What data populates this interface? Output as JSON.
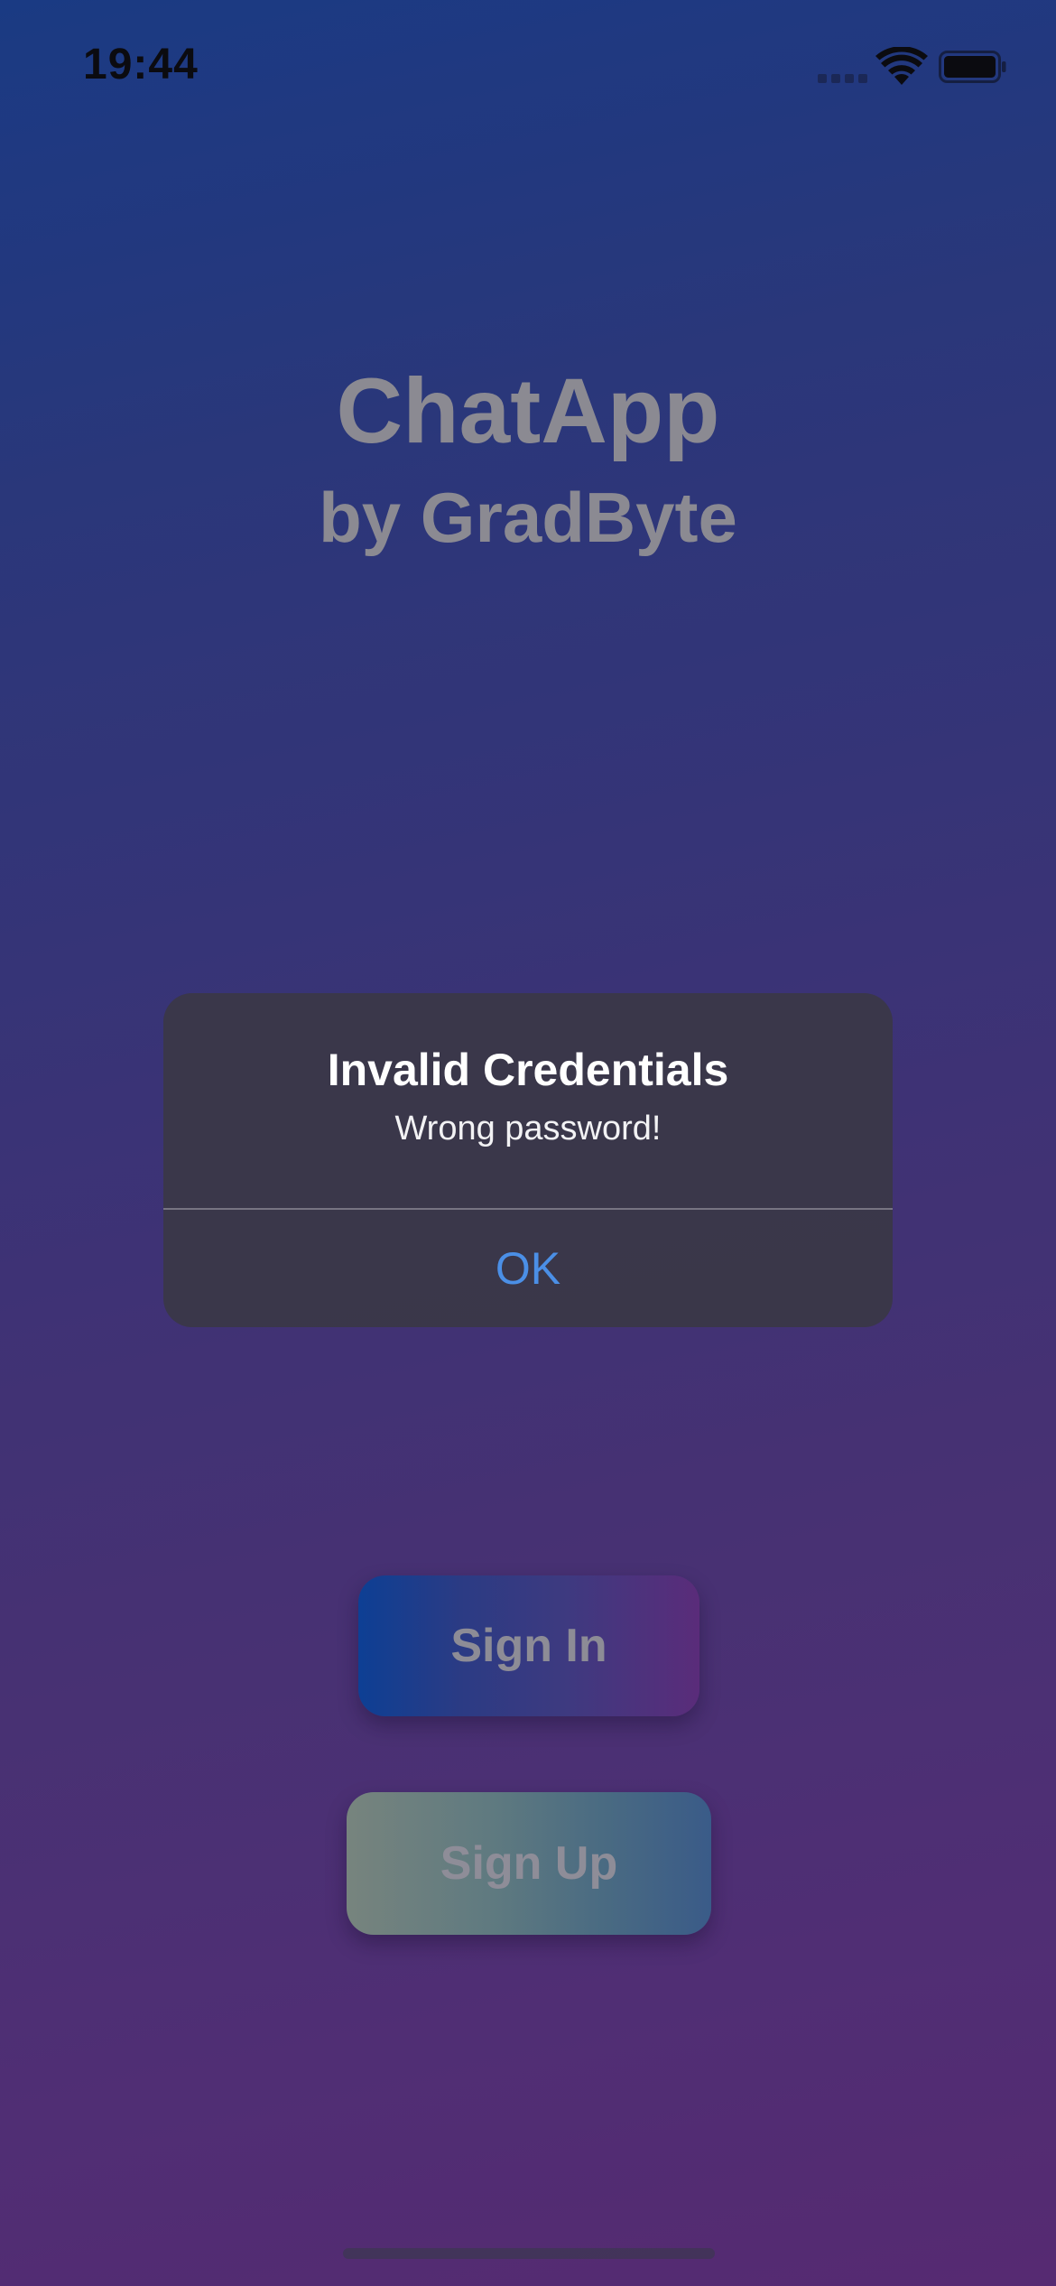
{
  "status_bar": {
    "time": "19:44",
    "icons": [
      "cellular-signal-icon",
      "wifi-icon",
      "battery-icon"
    ]
  },
  "app": {
    "title": "ChatApp",
    "subtitle": "by GradByte"
  },
  "alert": {
    "title": "Invalid Credentials",
    "message": "Wrong password!",
    "ok_label": "OK"
  },
  "buttons": {
    "sign_in": "Sign In",
    "sign_up": "Sign Up"
  },
  "colors": {
    "alert_action": "#4b8fe6",
    "background_top": "#1b3d8a",
    "background_bottom": "#5b2c77"
  }
}
